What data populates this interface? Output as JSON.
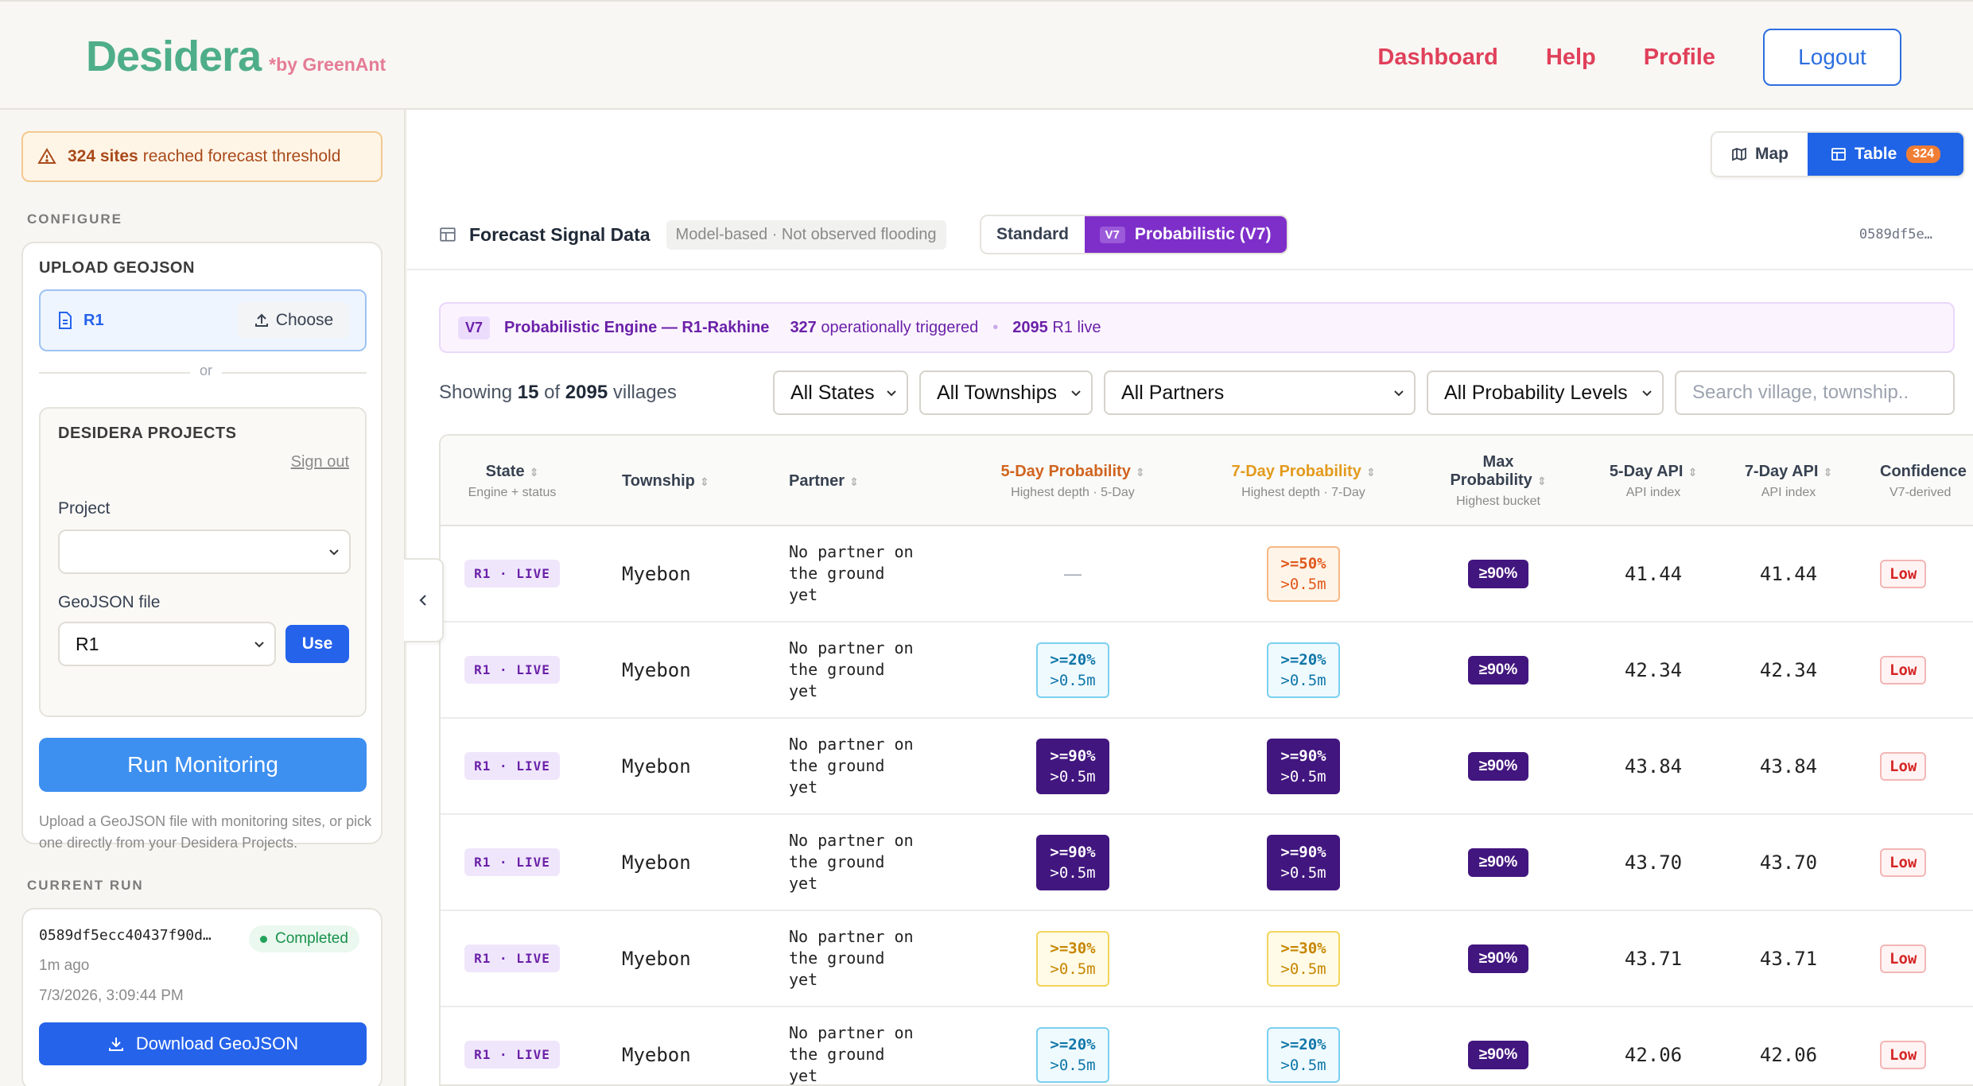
{
  "header": {
    "brand": "Desidera",
    "by": "*by GreenAnt",
    "nav": [
      "Dashboard",
      "Help",
      "Profile"
    ],
    "logout": "Logout"
  },
  "sidebar": {
    "alert_count": "324 sites",
    "alert_text": "reached forecast threshold",
    "configure_label": "CONFIGURE",
    "upload_title": "UPLOAD GEOJSON",
    "upload_file": "R1",
    "choose_label": "Choose",
    "or_label": "or",
    "projects_title": "DESIDERA PROJECTS",
    "sign_out": "Sign out",
    "project_label": "Project",
    "project_value": "",
    "geojson_label": "GeoJSON file",
    "geojson_value": "R1",
    "use_label": "Use",
    "run_label": "Run Monitoring",
    "help_text": "Upload a GeoJSON file with monitoring sites, or pick one directly from your Desidera Projects.",
    "current_run_label": "CURRENT RUN",
    "run_id": "0589df5ecc40437f90d…",
    "run_status": "Completed",
    "run_ago": "1m ago",
    "run_date": "7/3/2026, 3:09:44 PM",
    "download_label": "Download GeoJSON"
  },
  "main": {
    "view_map": "Map",
    "view_table": "Table",
    "table_count": "324",
    "title": "Forecast Signal Data",
    "subtitle_chip": "Model-based · Not observed flooding",
    "mode_standard": "Standard",
    "mode_v7_chip": "V7",
    "mode_prob": "Probabilistic (V7)",
    "hash": "0589df5e…",
    "engine_chip": "V7",
    "engine_title": "Probabilistic Engine — R1-Rakhine",
    "engine_triggered_num": "327",
    "engine_triggered_text": "operationally triggered",
    "engine_live_num": "2095",
    "engine_live_text": "R1 live",
    "showing_prefix": "Showing",
    "showing_count": "15",
    "showing_of": "of",
    "showing_total": "2095",
    "showing_suffix": "villages",
    "filters": [
      "All States",
      "All Townships",
      "All Partners",
      "All Probability Levels"
    ],
    "search_placeholder": "Search village, township..",
    "colors": {
      "accent": "#1f63e6",
      "purple": "#7e2fc9",
      "brand": "#4fae8a",
      "nav": "#e0405a"
    }
  },
  "table": {
    "headers": [
      {
        "h": "State",
        "sub": "Engine + status"
      },
      {
        "h": "Township",
        "sub": ""
      },
      {
        "h": "Partner",
        "sub": ""
      },
      {
        "h": "5-Day Probability",
        "sub": "Highest depth · 5-Day"
      },
      {
        "h": "7-Day Probability",
        "sub": "Highest depth · 7-Day"
      },
      {
        "h": "Max Probability",
        "sub": "Highest bucket"
      },
      {
        "h": "5-Day API",
        "sub": "API index"
      },
      {
        "h": "7-Day API",
        "sub": "API index"
      },
      {
        "h": "Confidence",
        "sub": "V7-derived"
      }
    ],
    "rows": [
      {
        "state": "R1 · LIVE",
        "township": "Myebon",
        "partner": "No partner on\nthe ground\nyet",
        "p5_top": "—",
        "p5_bot": "",
        "p5_class": "none",
        "p7_top": ">=50%",
        "p7_bot": ">0.5m",
        "p7_class": "pb-50",
        "max": "≥90%",
        "api5": "41.44",
        "api7": "41.44",
        "conf": "Low"
      },
      {
        "state": "R1 · LIVE",
        "township": "Myebon",
        "partner": "No partner on\nthe ground\nyet",
        "p5_top": ">=20%",
        "p5_bot": ">0.5m",
        "p5_class": "pb-20",
        "p7_top": ">=20%",
        "p7_bot": ">0.5m",
        "p7_class": "pb-20",
        "max": "≥90%",
        "api5": "42.34",
        "api7": "42.34",
        "conf": "Low"
      },
      {
        "state": "R1 · LIVE",
        "township": "Myebon",
        "partner": "No partner on\nthe ground\nyet",
        "p5_top": ">=90%",
        "p5_bot": ">0.5m",
        "p5_class": "pb-90",
        "p7_top": ">=90%",
        "p7_bot": ">0.5m",
        "p7_class": "pb-90",
        "max": "≥90%",
        "api5": "43.84",
        "api7": "43.84",
        "conf": "Low"
      },
      {
        "state": "R1 · LIVE",
        "township": "Myebon",
        "partner": "No partner on\nthe ground\nyet",
        "p5_top": ">=90%",
        "p5_bot": ">0.5m",
        "p5_class": "pb-90",
        "p7_top": ">=90%",
        "p7_bot": ">0.5m",
        "p7_class": "pb-90",
        "max": "≥90%",
        "api5": "43.70",
        "api7": "43.70",
        "conf": "Low"
      },
      {
        "state": "R1 · LIVE",
        "township": "Myebon",
        "partner": "No partner on\nthe ground\nyet",
        "p5_top": ">=30%",
        "p5_bot": ">0.5m",
        "p5_class": "pb-30",
        "p7_top": ">=30%",
        "p7_bot": ">0.5m",
        "p7_class": "pb-30",
        "max": "≥90%",
        "api5": "43.71",
        "api7": "43.71",
        "conf": "Low"
      },
      {
        "state": "R1 · LIVE",
        "township": "Myebon",
        "partner": "No partner on\nthe ground\nyet",
        "p5_top": ">=20%",
        "p5_bot": ">0.5m",
        "p5_class": "pb-20",
        "p7_top": ">=20%",
        "p7_bot": ">0.5m",
        "p7_class": "pb-20",
        "max": "≥90%",
        "api5": "42.06",
        "api7": "42.06",
        "conf": "Low"
      }
    ]
  }
}
